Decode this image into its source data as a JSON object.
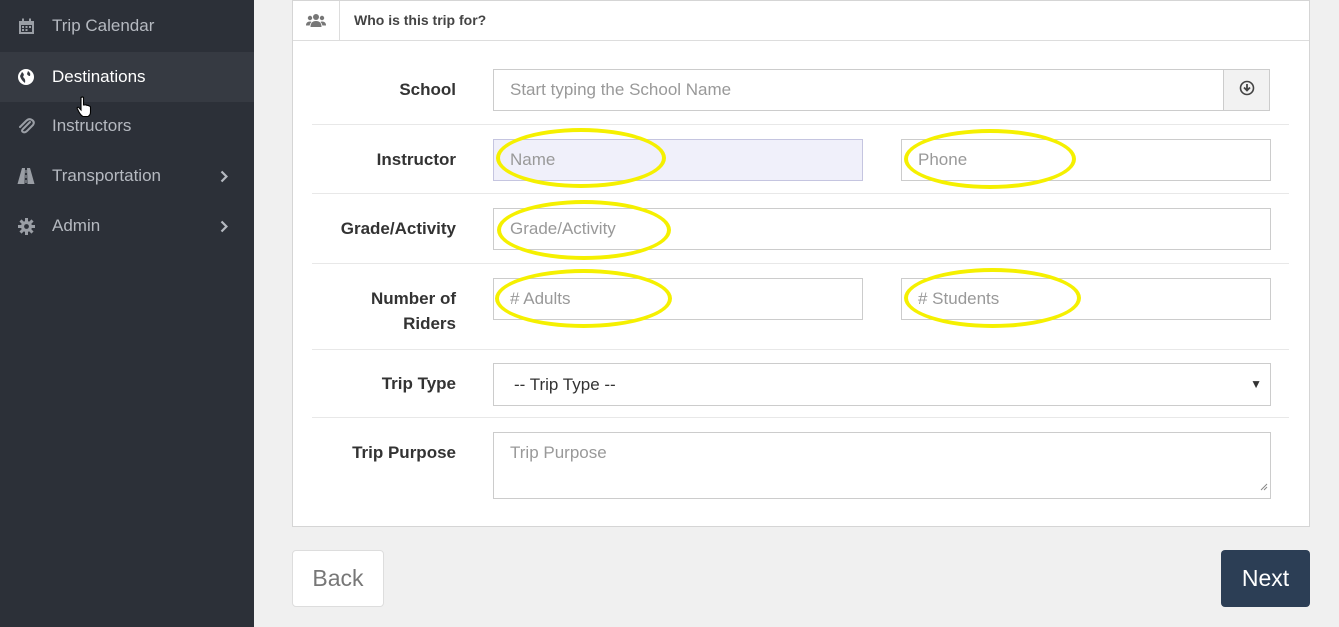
{
  "sidebar": {
    "items": [
      {
        "label": "Trip Calendar",
        "icon": "calendar-icon",
        "active": false,
        "has_submenu": false
      },
      {
        "label": "Destinations",
        "icon": "globe-icon",
        "active": true,
        "has_submenu": false
      },
      {
        "label": "Instructors",
        "icon": "paperclip-icon",
        "active": false,
        "has_submenu": false
      },
      {
        "label": "Transportation",
        "icon": "road-icon",
        "active": false,
        "has_submenu": true
      },
      {
        "label": "Admin",
        "icon": "gear-icon",
        "active": false,
        "has_submenu": true
      }
    ]
  },
  "panel": {
    "title": "Who is this trip for?",
    "icon": "users-icon"
  },
  "form": {
    "school": {
      "label": "School",
      "placeholder": "Start typing the School Name",
      "addon_icon": "circle-download-icon"
    },
    "instructor": {
      "label": "Instructor",
      "name_placeholder": "Name",
      "phone_placeholder": "Phone"
    },
    "grade": {
      "label": "Grade/Activity",
      "placeholder": "Grade/Activity"
    },
    "riders": {
      "label_line1": "Number of",
      "label_line2": "Riders",
      "adults_placeholder": "# Adults",
      "students_placeholder": "# Students"
    },
    "trip_type": {
      "label": "Trip Type",
      "selected": "-- Trip Type --"
    },
    "trip_purpose": {
      "label": "Trip Purpose",
      "placeholder": "Trip Purpose"
    }
  },
  "buttons": {
    "back": "Back",
    "next": "Next"
  },
  "colors": {
    "sidebar_bg": "#2c3038",
    "sidebar_active_bg": "#363a42",
    "highlight": "#f5f000",
    "next_button_bg": "#2c3e55"
  }
}
